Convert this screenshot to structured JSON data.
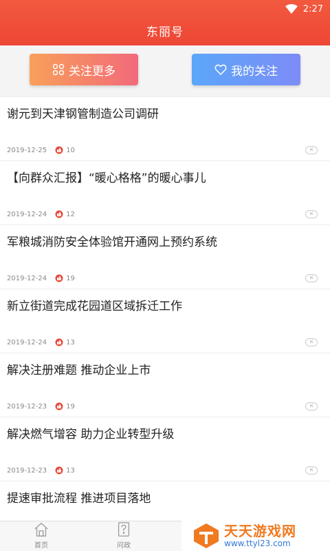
{
  "status_bar": {
    "time": "2:27",
    "wifi_icon": "wifi-icon"
  },
  "header": {
    "title": "东丽号",
    "background": "#ef4c38"
  },
  "actions": {
    "follow_more": {
      "label": "关注更多",
      "icon": "grid-icon"
    },
    "my_follows": {
      "label": "我的关注",
      "icon": "heart-icon"
    }
  },
  "articles": [
    {
      "title": "谢元到天津钢管制造公司调研",
      "date": "2019-12-25",
      "likes": "10"
    },
    {
      "title": "【向群众汇报】“暖心格格”的暖心事儿",
      "date": "2019-12-24",
      "likes": "12"
    },
    {
      "title": "军粮城消防安全体验馆开通网上预约系统",
      "date": "2019-12-24",
      "likes": "19"
    },
    {
      "title": "新立街道完成花园道区域拆迁工作",
      "date": "2019-12-24",
      "likes": "13"
    },
    {
      "title": "解决注册难题 推动企业上市",
      "date": "2019-12-23",
      "likes": "19"
    },
    {
      "title": "解决燃气增容 助力企业转型升级",
      "date": "2019-12-23",
      "likes": "13"
    },
    {
      "title": "提速审批流程 推进项目落地",
      "date": "",
      "likes": ""
    }
  ],
  "tabbar": [
    {
      "label": "首页",
      "icon": "home-icon"
    },
    {
      "label": "问政",
      "icon": "question-doc-icon"
    }
  ],
  "watermark": {
    "name": "天天游戏网",
    "url": "www.ttyl23.com"
  }
}
